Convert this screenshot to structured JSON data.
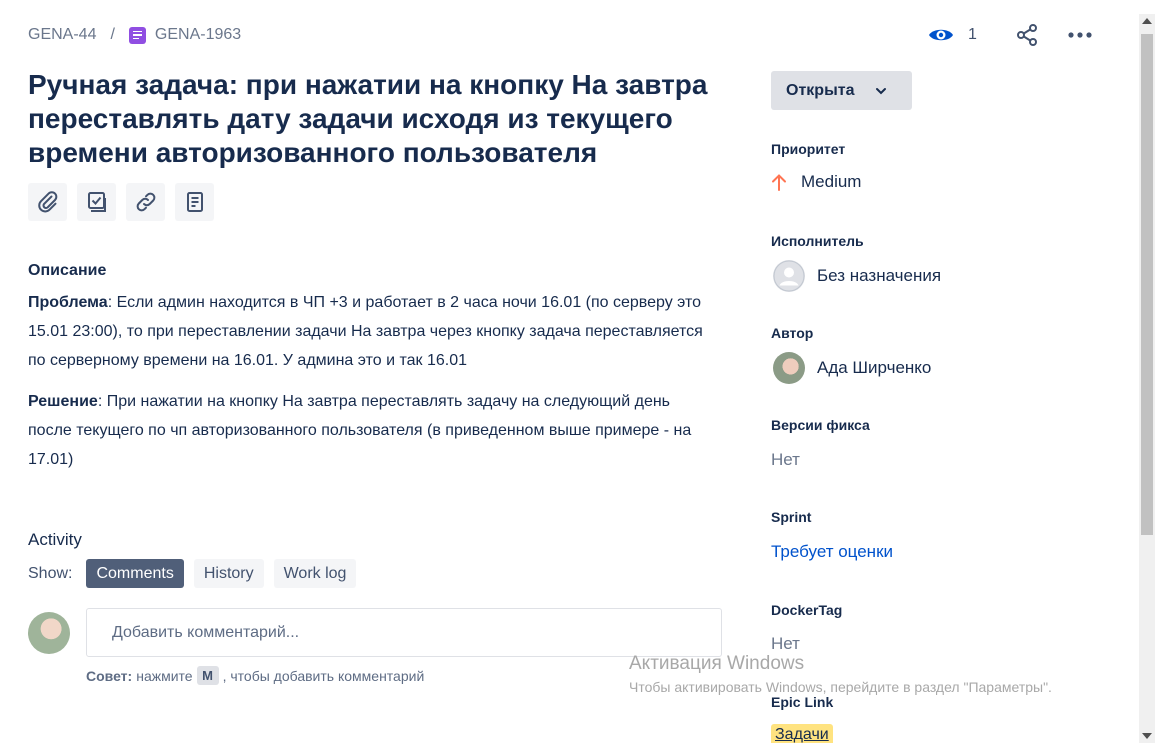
{
  "breadcrumb": {
    "parent": "GENA-44",
    "separator": "/",
    "issue_key": "GENA-1963",
    "issue_type_icon": "task-icon"
  },
  "header": {
    "watchers_count": "1",
    "watch_icon": "eye-icon",
    "share_icon": "share-icon",
    "more_icon": "more-icon"
  },
  "issue": {
    "title": "Ручная задача: при нажатии на кнопку На завтра переставлять дату задачи исходя из текущего времени авторизованного пользователя"
  },
  "toolbar": {
    "icons": [
      "paperclip-icon",
      "checklist-icon",
      "link-icon",
      "page-icon"
    ]
  },
  "description": {
    "heading": "Описание",
    "problem_label": "Проблема",
    "problem_text": ": Если админ находится в ЧП +3 и работает в 2 часа ночи 16.01 (по серверу это 15.01 23:00), то при переставлении задачи На завтра через кнопку задача переставляется по серверному времени на 16.01. У админа это и так 16.01",
    "solution_label": "Решение",
    "solution_text": ": При нажатии на кнопку На завтра переставлять задачу на следующий день после текущего по чп авторизованного пользователя (в приведенном выше примере - на 17.01)"
  },
  "activity": {
    "heading": "Activity",
    "show_label": "Show:",
    "tabs": [
      {
        "label": "Comments",
        "active": true
      },
      {
        "label": "History",
        "active": false
      },
      {
        "label": "Work log",
        "active": false
      }
    ],
    "comment_placeholder": "Добавить комментарий...",
    "tip_label": "Совет:",
    "tip_before": "нажмите",
    "tip_key": "M",
    "tip_after": ", чтобы добавить комментарий"
  },
  "sidebar": {
    "status": "Открыта",
    "priority_label": "Приоритет",
    "priority_value": "Medium",
    "priority_color": "#ff7452",
    "assignee_label": "Исполнитель",
    "assignee_value": "Без назначения",
    "reporter_label": "Автор",
    "reporter_value": "Ада Ширченко",
    "fix_versions_label": "Версии фикса",
    "fix_versions_value": "Нет",
    "sprint_label": "Sprint",
    "sprint_value": "Требует оценки",
    "dockertag_label": "DockerTag",
    "dockertag_value": "Нет",
    "epic_label": "Epic Link",
    "epic_value": "Задачи",
    "epic_color": "#ffe380"
  },
  "watermark": {
    "line1": "Активация Windows",
    "line2": "Чтобы активировать Windows, перейдите в раздел \"Параметры\"."
  }
}
